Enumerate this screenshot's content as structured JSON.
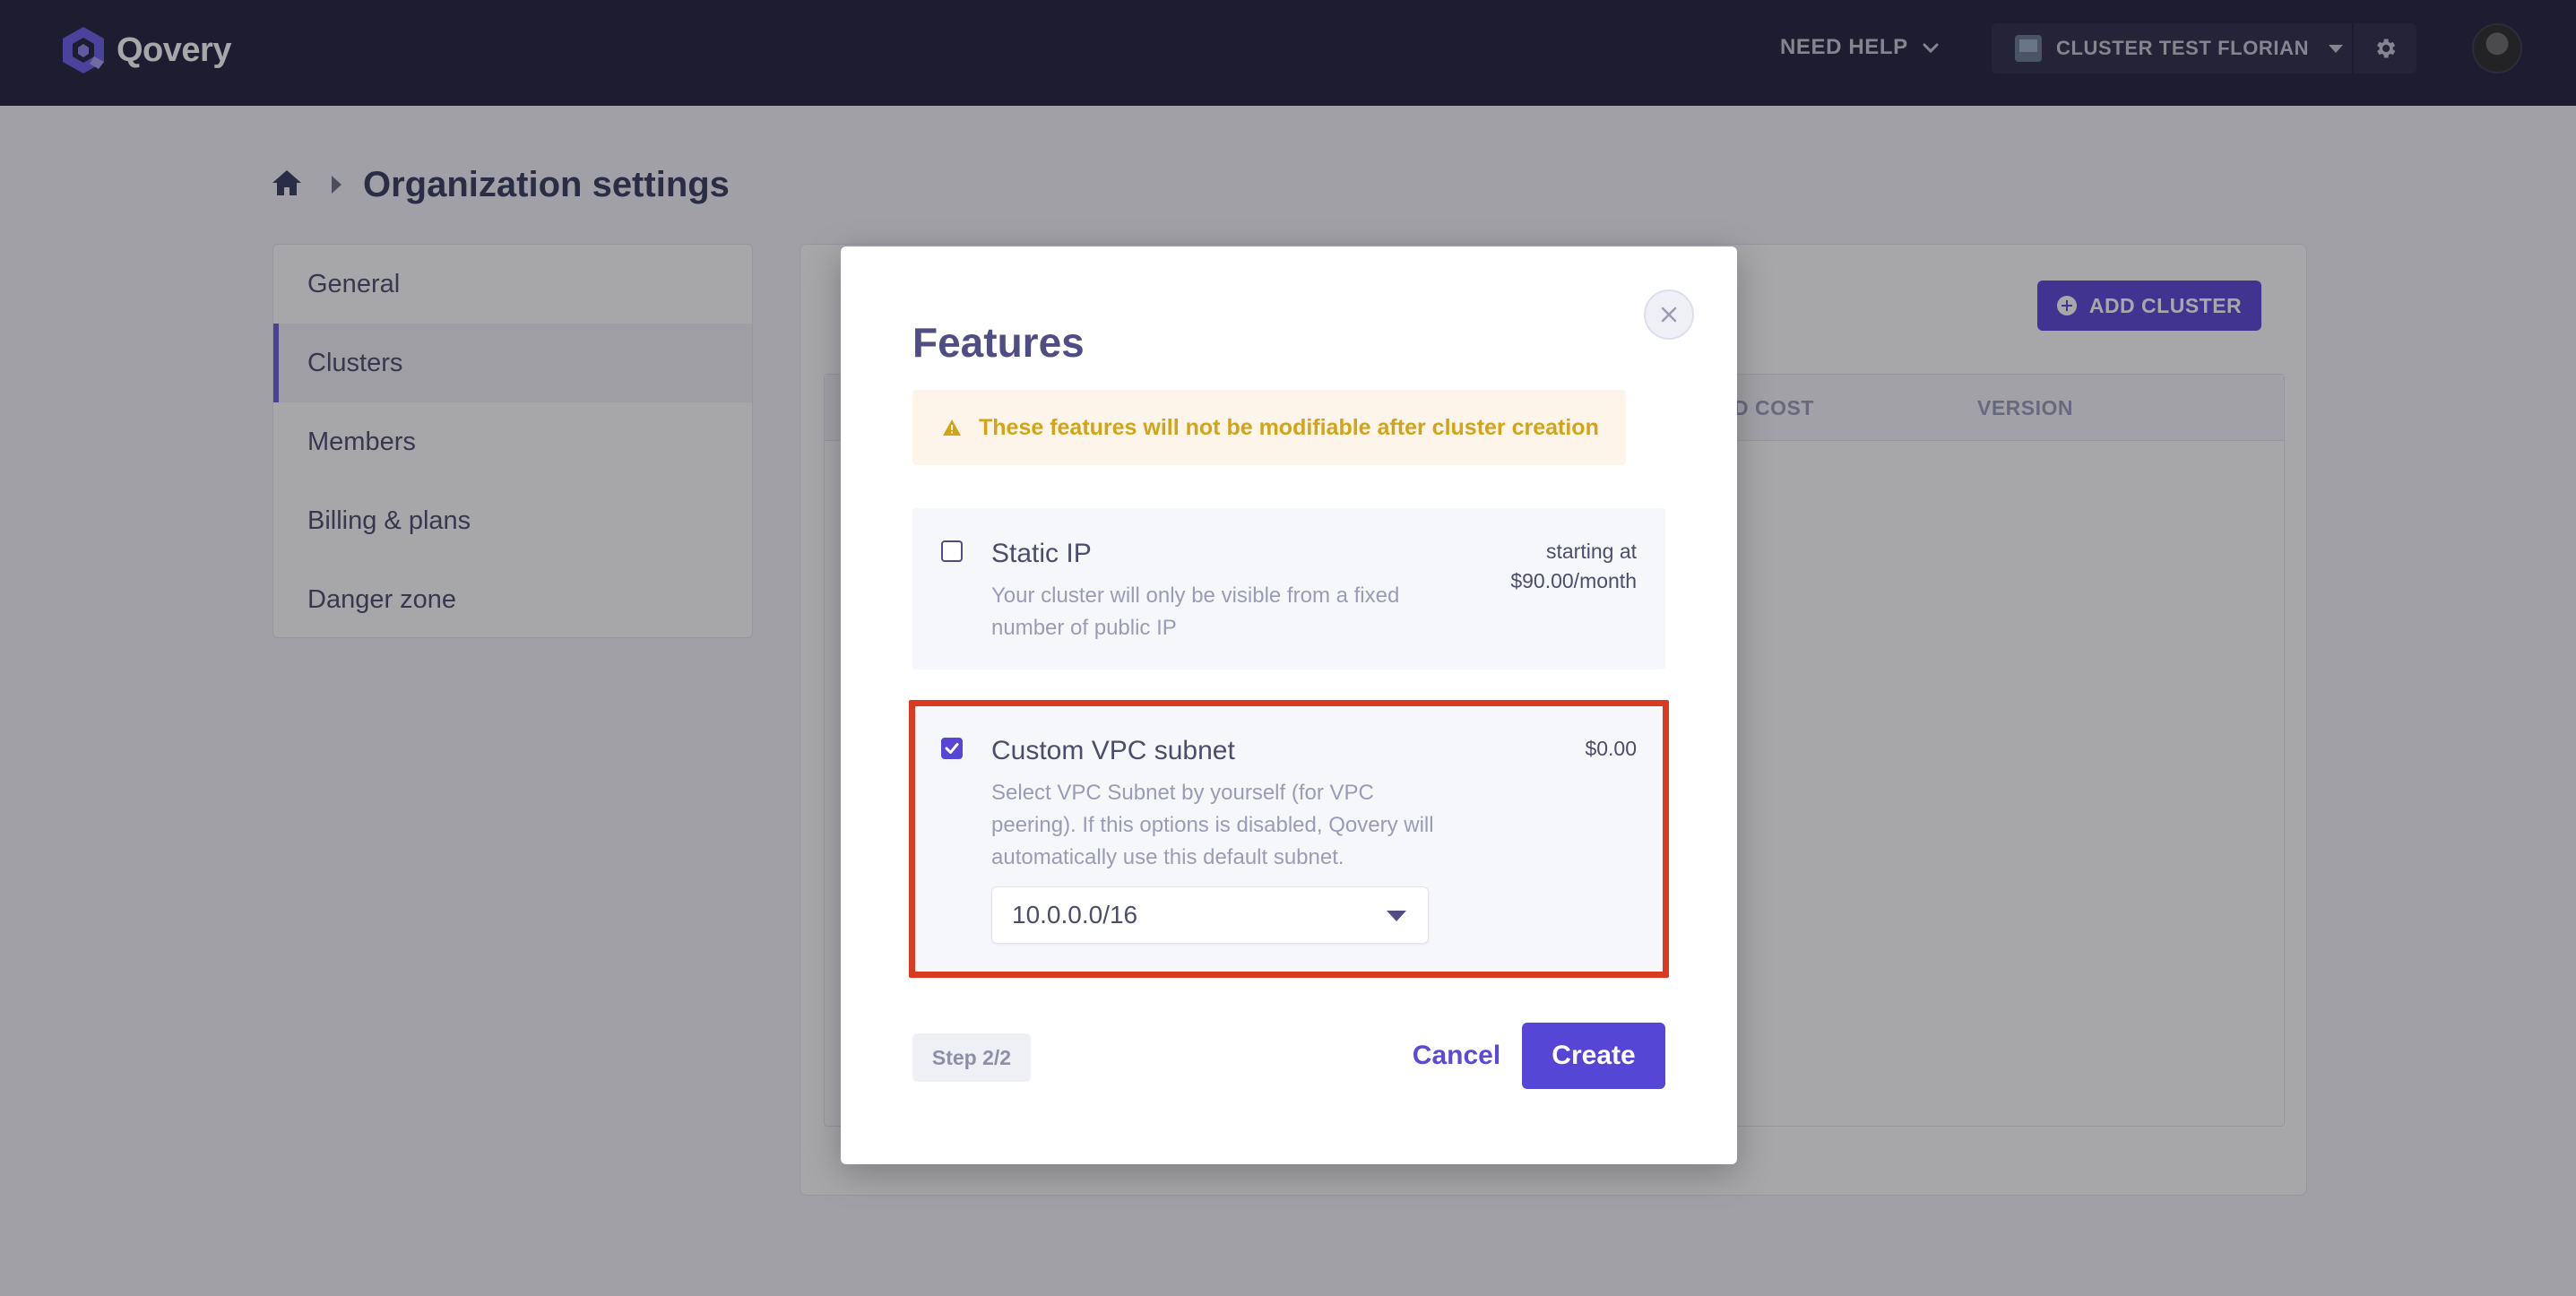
{
  "topbar": {
    "logo_text": "Qovery",
    "need_help": "NEED HELP",
    "cluster_label": "CLUSTER TEST FLORIAN"
  },
  "page": {
    "title": "Organization settings"
  },
  "side_menu": {
    "items": [
      {
        "label": "General"
      },
      {
        "label": "Clusters"
      },
      {
        "label": "Members"
      },
      {
        "label": "Billing & plans"
      },
      {
        "label": "Danger zone"
      }
    ],
    "active": "Clusters"
  },
  "clusters_panel": {
    "add_button": "ADD CLUSTER",
    "columns": [
      "D COST",
      "VERSION"
    ]
  },
  "modal": {
    "title": "Features",
    "warning": "These features will not be modifiable after cluster creation",
    "features": [
      {
        "title": "Static IP",
        "description": "Your cluster will only be visible from a fixed number of public IP",
        "price_line1": "starting at",
        "price_line2": "$90.00/month",
        "checked": false
      },
      {
        "title": "Custom VPC subnet",
        "description": "Select VPC Subnet by yourself (for VPC peering). If this options is disabled, Qovery will automatically use this default subnet.",
        "price": "$0.00",
        "checked": true,
        "subnet_value": "10.0.0.0/16"
      }
    ],
    "step": "Step 2/2",
    "cancel": "Cancel",
    "create": "Create"
  },
  "colors": {
    "brand": "#5546d6",
    "topbar": "#211f3b",
    "highlight_outline": "#d93a22",
    "warning_text": "#d2a418"
  }
}
